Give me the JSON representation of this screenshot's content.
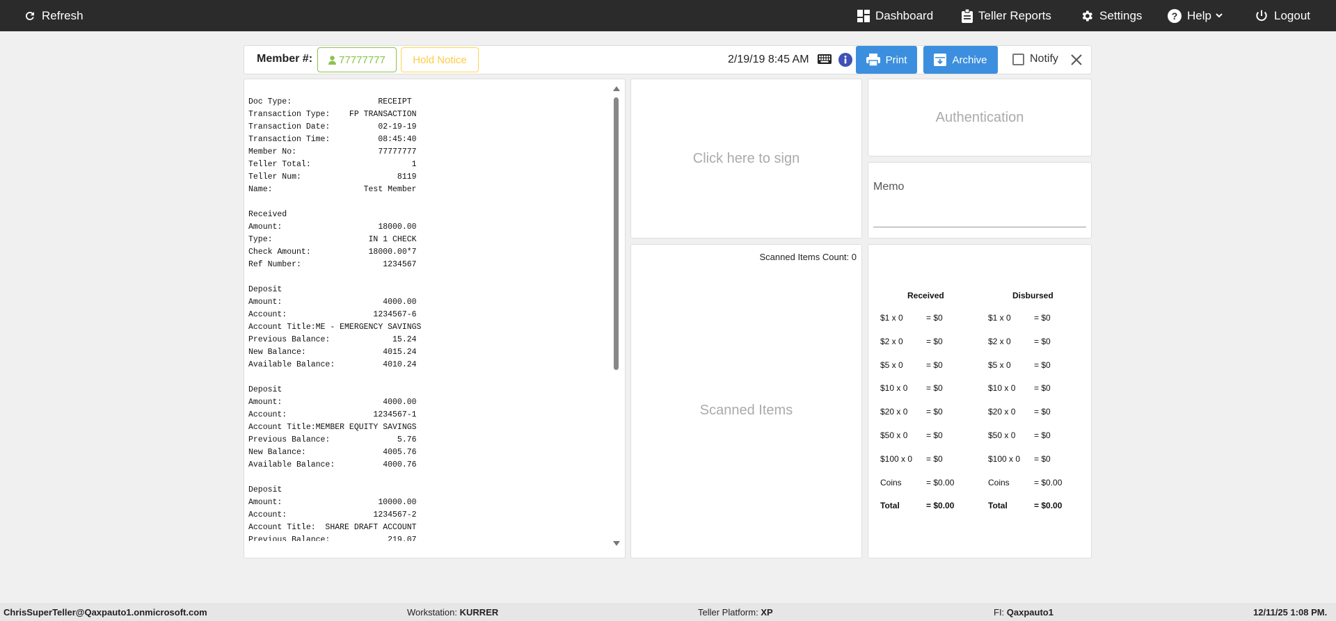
{
  "topbar": {
    "refresh": "Refresh",
    "dashboard": "Dashboard",
    "teller_reports": "Teller Reports",
    "settings": "Settings",
    "help": "Help",
    "logout": "Logout"
  },
  "header": {
    "member_label": "Member #:",
    "member_number": "77777777",
    "hold_notice": "Hold Notice",
    "datetime": "2/19/19 8:45 AM",
    "print": "Print",
    "archive": "Archive",
    "notify": "Notify"
  },
  "receipt": {
    "lines": [
      "Doc Type:                  RECEIPT",
      "Transaction Type:    FP TRANSACTION",
      "Transaction Date:          02-19-19",
      "Transaction Time:          08:45:40",
      "Member No:                 77777777",
      "Teller Total:                     1",
      "Teller Num:                    8119",
      "Name:                   Test Member",
      "",
      "Received",
      "Amount:                    18000.00",
      "Type:                    IN 1 CHECK",
      "Check Amount:            18000.00*7",
      "Ref Number:                 1234567",
      "",
      "Deposit",
      "Amount:                     4000.00",
      "Account:                  1234567-6",
      "Account Title:ME - EMERGENCY SAVINGS",
      "Previous Balance:             15.24",
      "New Balance:                4015.24",
      "Available Balance:          4010.24",
      "",
      "Deposit",
      "Amount:                     4000.00",
      "Account:                  1234567-1",
      "Account Title:MEMBER EQUITY SAVINGS",
      "Previous Balance:              5.76",
      "New Balance:                4005.76",
      "Available Balance:          4000.76",
      "",
      "Deposit",
      "Amount:                    10000.00",
      "Account:                  1234567-2",
      "Account Title:  SHARE DRAFT ACCOUNT",
      "Previous Balance:            219.07"
    ]
  },
  "signature": {
    "label": "Click here to sign"
  },
  "scanned": {
    "count_label": "Scanned Items Count: 0",
    "title": "Scanned Items"
  },
  "auth": {
    "label": "Authentication"
  },
  "memo": {
    "label": "Memo"
  },
  "cash": {
    "received_header": "Received",
    "disbursed_header": "Disbursed",
    "received": [
      {
        "label": "$1 x 0",
        "value": "= $0"
      },
      {
        "label": "$2 x 0",
        "value": "= $0"
      },
      {
        "label": "$5 x 0",
        "value": "= $0"
      },
      {
        "label": "$10 x 0",
        "value": "= $0"
      },
      {
        "label": "$20 x 0",
        "value": "= $0"
      },
      {
        "label": "$50 x 0",
        "value": "= $0"
      },
      {
        "label": "$100 x 0",
        "value": "= $0"
      },
      {
        "label": "Coins",
        "value": "= $0.00"
      },
      {
        "label": "Total",
        "value": "= $0.00"
      }
    ],
    "disbursed": [
      {
        "label": "$1 x 0",
        "value": "= $0"
      },
      {
        "label": "$2 x 0",
        "value": "= $0"
      },
      {
        "label": "$5 x 0",
        "value": "= $0"
      },
      {
        "label": "$10 x 0",
        "value": "= $0"
      },
      {
        "label": "$20 x 0",
        "value": "= $0"
      },
      {
        "label": "$50 x 0",
        "value": "= $0"
      },
      {
        "label": "$100 x 0",
        "value": "= $0"
      },
      {
        "label": "Coins",
        "value": "= $0.00"
      },
      {
        "label": "Total",
        "value": "= $0.00"
      }
    ]
  },
  "footer": {
    "user": "ChrisSuperTeller@Qaxpauto1.onmicrosoft.com",
    "workstation_label": "Workstation:",
    "workstation": "KURRER",
    "platform_label": "Teller Platform:",
    "platform": "XP",
    "fi_label": "FI:",
    "fi": "Qaxpauto1",
    "datetime": "12/11/25 1:08 PM."
  },
  "colors": {
    "topbar_bg": "#2b2b2b",
    "primary_button": "#3b8fde",
    "member_chip": "#8bc34a",
    "hold_chip": "#ffcb47",
    "info_icon": "#3f51b5"
  }
}
